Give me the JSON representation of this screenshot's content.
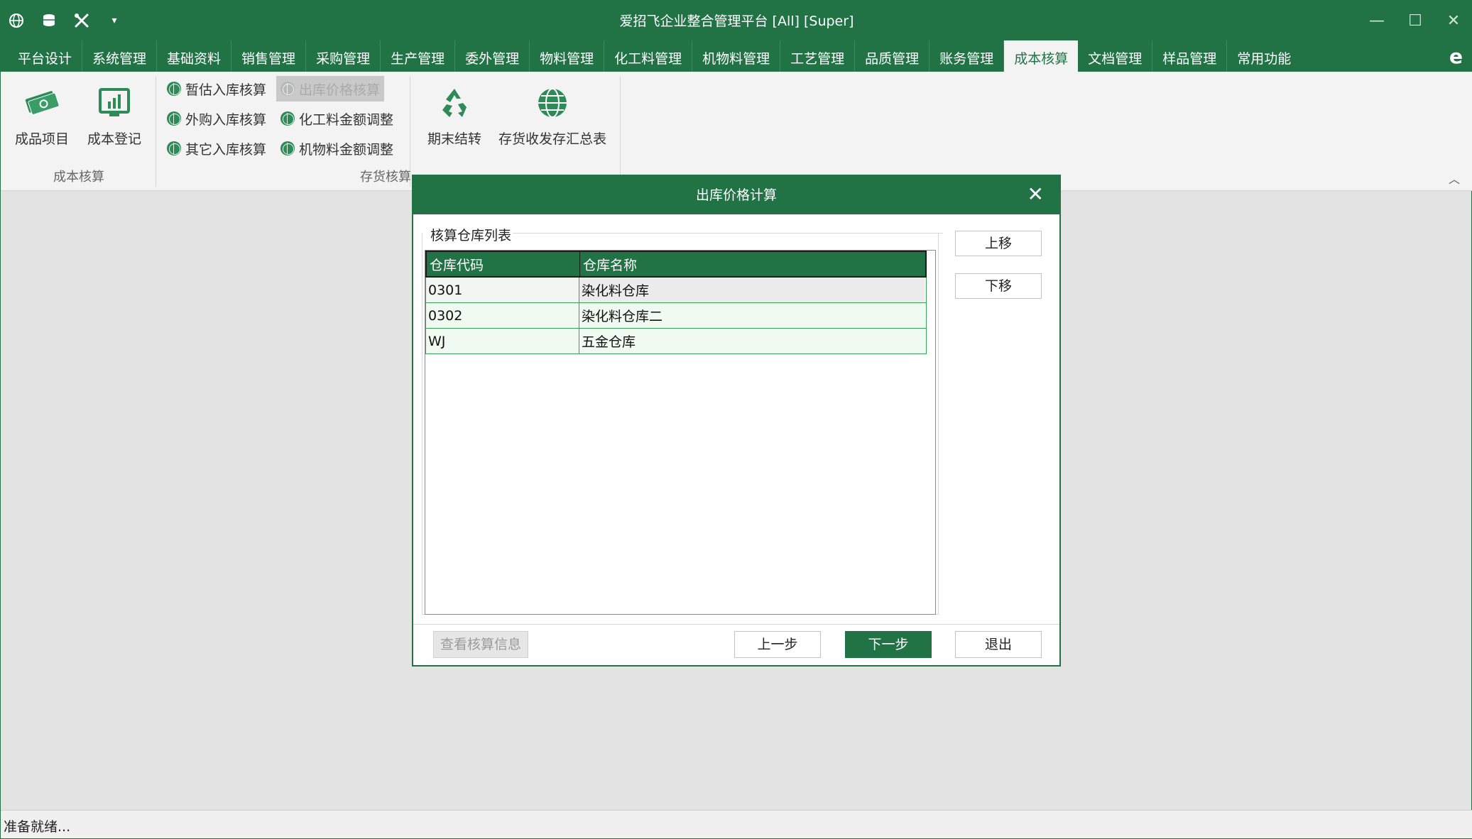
{
  "window": {
    "title": "爱招飞企业整合管理平台 [All] [Super]",
    "controls": [
      "—",
      "☐",
      "✕"
    ]
  },
  "qat": {
    "overflow": "▾"
  },
  "tabs": [
    {
      "label": "平台设计"
    },
    {
      "label": "系统管理"
    },
    {
      "label": "基础资料"
    },
    {
      "label": "销售管理"
    },
    {
      "label": "采购管理"
    },
    {
      "label": "生产管理"
    },
    {
      "label": "委外管理"
    },
    {
      "label": "物料管理"
    },
    {
      "label": "化工料管理"
    },
    {
      "label": "机物料管理"
    },
    {
      "label": "工艺管理"
    },
    {
      "label": "品质管理"
    },
    {
      "label": "账务管理"
    },
    {
      "label": "成本核算"
    },
    {
      "label": "文档管理"
    },
    {
      "label": "样品管理"
    },
    {
      "label": "常用功能"
    }
  ],
  "active_tab_index": 13,
  "ribbon": {
    "group1": {
      "label": "成本核算",
      "buttons": [
        {
          "label": "成品项目"
        },
        {
          "label": "成本登记"
        }
      ]
    },
    "group2": {
      "label": "存货核算",
      "small_buttons": [
        {
          "label": "暂估入库核算"
        },
        {
          "label": "出库价格核算"
        },
        {
          "label": "外购入库核算"
        },
        {
          "label": "化工料金额调整"
        },
        {
          "label": "其它入库核算"
        },
        {
          "label": "机物料金额调整"
        }
      ],
      "big_buttons": [
        {
          "label": "期末结转"
        },
        {
          "label": "存货收发存汇总表"
        }
      ]
    }
  },
  "dialog": {
    "title": "出库价格计算",
    "close": "✕",
    "list_title": "核算仓库列表",
    "columns": [
      "仓库代码",
      "仓库名称"
    ],
    "rows": [
      {
        "code": "0301",
        "name": "染化料仓库"
      },
      {
        "code": "0302",
        "name": "染化料仓库二"
      },
      {
        "code": "WJ",
        "name": "五金仓库"
      }
    ],
    "move_up": "上移",
    "move_down": "下移",
    "view_info": "查看核算信息",
    "prev": "上一步",
    "next": "下一步",
    "exit": "退出"
  },
  "status": {
    "text": "准备就绪..."
  },
  "colors": {
    "brand": "#217346",
    "row_border": "#3aa35a"
  }
}
